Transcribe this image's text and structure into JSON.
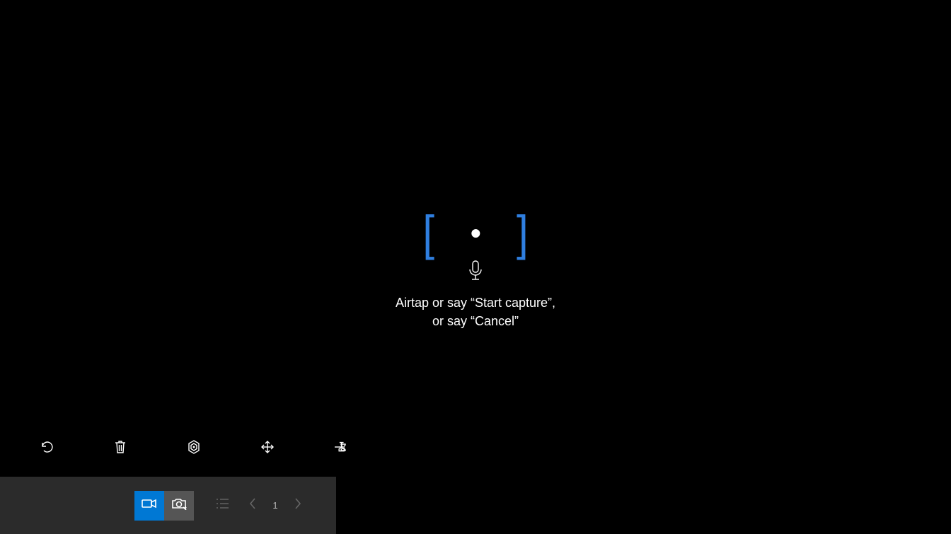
{
  "viewfinder": {
    "bracket_color": "#2f7fe0"
  },
  "instruction": {
    "line1": "Airtap or say “Start capture”,",
    "line2": "or say “Cancel”"
  },
  "mid_toolbar": {
    "items": [
      {
        "name": "undo-icon"
      },
      {
        "name": "delete-icon"
      },
      {
        "name": "target-icon"
      },
      {
        "name": "move-icon"
      },
      {
        "name": "pin-icon"
      }
    ]
  },
  "bottom_bar": {
    "video_active": true,
    "photo_active": false,
    "page_number": "1"
  },
  "colors": {
    "accent": "#0078d4",
    "bottom_bar_bg": "#2b2b2b"
  }
}
